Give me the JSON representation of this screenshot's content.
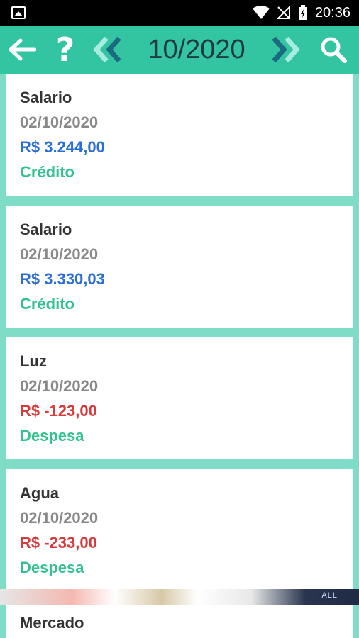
{
  "status": {
    "time": "20:36"
  },
  "toolbar": {
    "month": "10/2020"
  },
  "entries": [
    {
      "description": "Salario",
      "date": "02/10/2020",
      "amount": "R$ 3.244,00",
      "type": "Crédito"
    },
    {
      "description": "Salario",
      "date": "02/10/2020",
      "amount": "R$ 3.330,03",
      "type": "Crédito"
    },
    {
      "description": "Luz",
      "date": "02/10/2020",
      "amount": "R$ -123,00",
      "type": "Despesa"
    },
    {
      "description": "Agua",
      "date": "02/10/2020",
      "amount": "R$ -233,00",
      "type": "Despesa"
    },
    {
      "description": "Mercado"
    }
  ],
  "ad": {
    "text": "ALL"
  },
  "colors": {
    "toolbar": "#33c4a1",
    "background": "#7fdcc6",
    "credit_amount": "#2a6fd6",
    "debit_amount": "#d83b3b",
    "type_label": "#33c28f"
  }
}
